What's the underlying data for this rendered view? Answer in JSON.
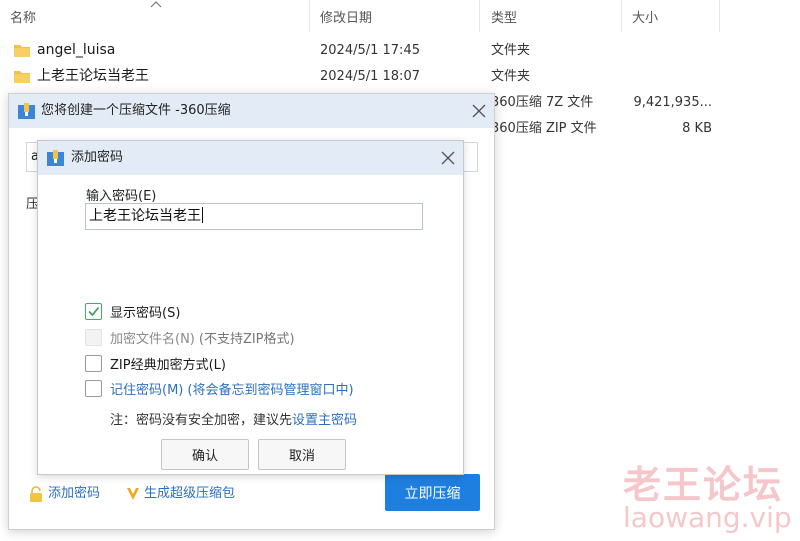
{
  "explorer": {
    "columns": {
      "name": "名称",
      "date": "修改日期",
      "type": "类型",
      "size": "大小"
    },
    "files": [
      {
        "name": "angel_luisa",
        "date": "2024/5/1 17:45",
        "type": "文件夹",
        "size": "",
        "icon": "folder-icon"
      },
      {
        "name": "上老王论坛当老王",
        "date": "2024/5/1 18:07",
        "type": "文件夹",
        "size": "",
        "icon": "folder-icon"
      },
      {
        "name": "",
        "date": "",
        "type": "360压缩 7Z 文件",
        "size": "9,421,935...",
        "icon": "archive-icon"
      },
      {
        "name": "",
        "date": "",
        "type": "360压缩 ZIP 文件",
        "size": "8 KB",
        "icon": "archive-icon"
      }
    ]
  },
  "compress_dialog": {
    "title": "您将创建一个压缩文件 -360压缩",
    "path_value_partial": "a",
    "label_partial": "压",
    "footer": {
      "add_password": "添加密码",
      "make_super": "生成超级压缩包",
      "compress_now": "立即压缩"
    }
  },
  "password_dialog": {
    "title": "添加密码",
    "input_label": "输入密码(E)",
    "password_value": "上老王论坛当老王",
    "options": [
      {
        "label": "显示密码(S)",
        "hint": "",
        "checked": true,
        "disabled": false
      },
      {
        "label": "加密文件名(N)",
        "hint": "(不支持ZIP格式)",
        "checked": false,
        "disabled": true
      },
      {
        "label": "ZIP经典加密方式(L)",
        "hint": "",
        "checked": false,
        "disabled": false
      },
      {
        "label": "记住密码(M)",
        "hint": "(将会备忘到密码管理窗口中)",
        "checked": false,
        "disabled": false
      }
    ],
    "note_prefix": "注：密码没有安全加密，建议先",
    "note_link": "设置主密码",
    "ok_label": "确认",
    "cancel_label": "取消"
  },
  "watermark": {
    "cn": "老王论坛",
    "en": "laowang.vip"
  },
  "colors": {
    "accent": "#1f7fe0",
    "link": "#2b6fc2",
    "titlebar": "#e3ecf6",
    "check": "#4aa86a"
  }
}
